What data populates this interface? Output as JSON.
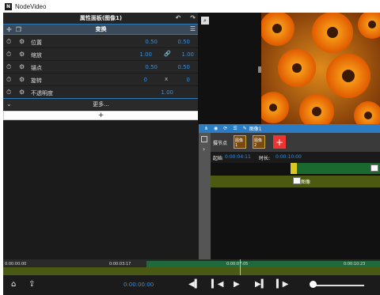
{
  "titlebar": {
    "app_name": "NodeVideo",
    "logo_letter": "N"
  },
  "panel": {
    "title": "属性面板(图像1)",
    "section": "变换",
    "rows": [
      {
        "name": "位置",
        "v1": "0.50",
        "mid": "",
        "v2": "0.50"
      },
      {
        "name": "缩放",
        "v1": "1.00",
        "mid": "link-icon",
        "v2": "1.00"
      },
      {
        "name": "锚点",
        "v1": "0.50",
        "mid": "",
        "v2": "0.50"
      },
      {
        "name": "旋转",
        "v1": "0",
        "mid": "x",
        "v2": "0"
      },
      {
        "name": "不透明度",
        "v1": "",
        "mid": "",
        "v2": "1.00"
      }
    ],
    "more_label": "更多...",
    "add_label": "+"
  },
  "timeline": {
    "toolbar_label": "图像1",
    "nodes_label": "摄节点",
    "node1_label": "图像1",
    "node2_label": "图像2",
    "start_label": "起始",
    "start_time": "0:00:04:11",
    "duration_label": "时长:",
    "duration_time": "0:00:10:00",
    "track_label": "图像"
  },
  "ruler": {
    "labels": [
      "0:00:00:00",
      "0:00:03:17",
      "0:00:07:05",
      "0:00:10:23"
    ]
  },
  "controls": {
    "current_time": "0:00:00:00"
  },
  "colors": {
    "accent": "#2c7cc4",
    "value_blue": "#3d8fd8",
    "track_green": "#1f6a3a",
    "track_olive": "#4b5a10"
  }
}
